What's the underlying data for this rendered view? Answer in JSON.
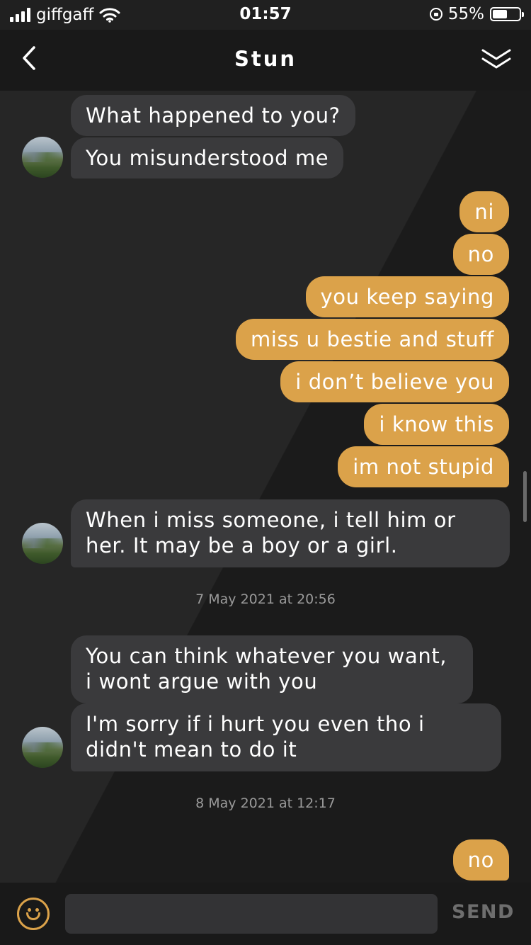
{
  "status_bar": {
    "carrier": "giffgaff",
    "time": "01:57",
    "battery_percent": "55%",
    "battery_level": 0.55,
    "icons": [
      "signal-icon",
      "wifi-icon",
      "orientation-lock-icon",
      "battery-icon"
    ]
  },
  "nav": {
    "title": "Stun",
    "back_icon": "chevron-left-icon",
    "collapse_icon": "double-chevron-down-icon"
  },
  "messages": [
    {
      "id": "m1",
      "direction": "incoming",
      "text": "What happened to you?"
    },
    {
      "id": "m2",
      "direction": "incoming",
      "text": "You misunderstood me"
    },
    {
      "id": "m3",
      "direction": "outgoing",
      "text": "ni"
    },
    {
      "id": "m4",
      "direction": "outgoing",
      "text": "no"
    },
    {
      "id": "m5",
      "direction": "outgoing",
      "text": "you keep saying"
    },
    {
      "id": "m6",
      "direction": "outgoing",
      "text": "miss u bestie and stuff"
    },
    {
      "id": "m7",
      "direction": "outgoing",
      "text": "i don’t believe you"
    },
    {
      "id": "m8",
      "direction": "outgoing",
      "text": "i know this"
    },
    {
      "id": "m9",
      "direction": "outgoing",
      "text": "im not stupid"
    },
    {
      "id": "m10",
      "direction": "incoming",
      "text": "When i miss someone, i tell him or her. It may be a boy or a girl."
    },
    {
      "id": "m11",
      "direction": "incoming",
      "text": "You can think whatever you want, i wont argue with you"
    },
    {
      "id": "m12",
      "direction": "incoming",
      "text": "I'm sorry if i hurt you even tho i didn't mean to do it"
    },
    {
      "id": "m13",
      "direction": "outgoing",
      "text": "no"
    }
  ],
  "timestamps": {
    "t1": "7 May 2021 at 20:56",
    "t2": "8 May 2021 at 12:17"
  },
  "composer": {
    "emoji_icon": "smiley-icon",
    "input_value": "",
    "input_placeholder": "",
    "send_label": "SEND"
  },
  "colors": {
    "background": "#202020",
    "incoming_bubble": "#3a3a3c",
    "outgoing_bubble": "#dba24a",
    "send_disabled": "#6e6e6e"
  }
}
